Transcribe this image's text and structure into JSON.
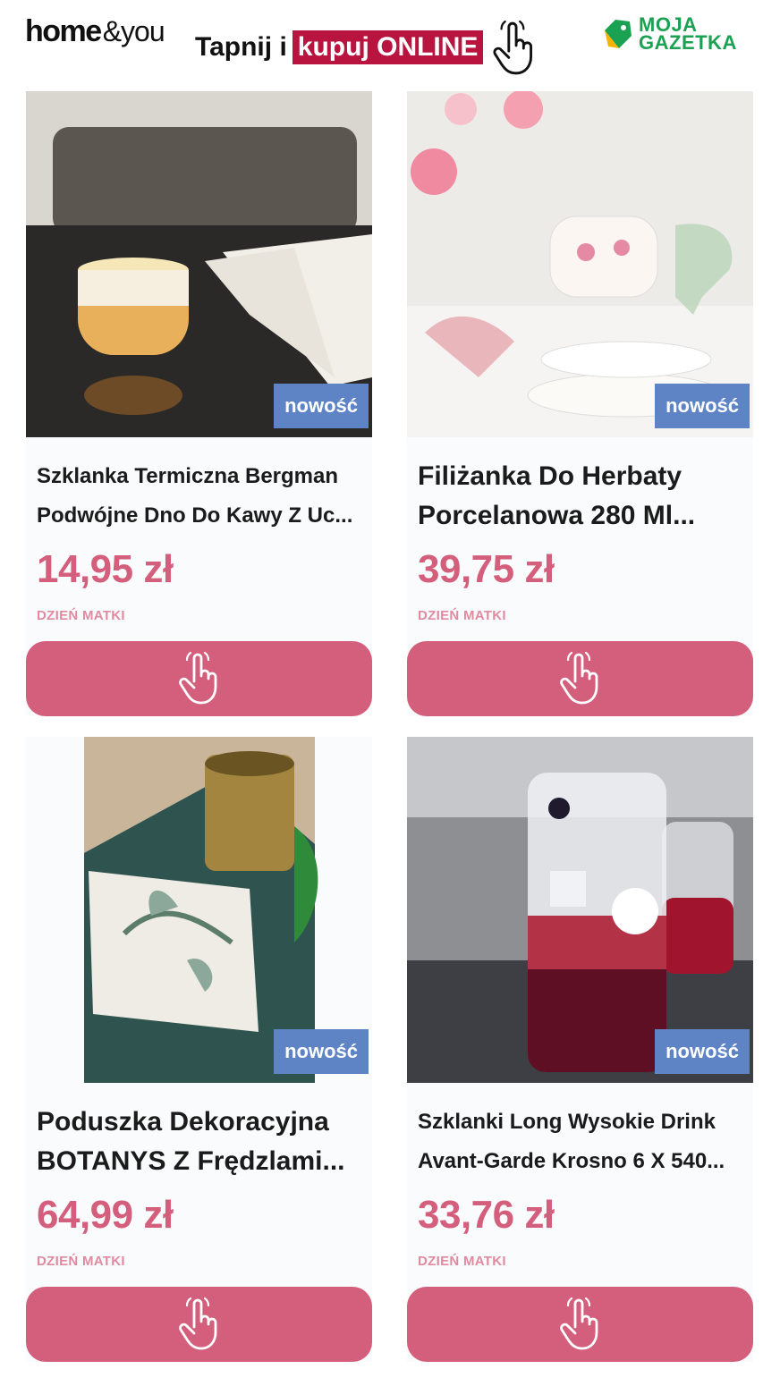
{
  "header": {
    "brand_home": "home",
    "brand_you": "&you",
    "promo_prefix": "Tapnij i",
    "promo_highlight": "kupuj ONLINE",
    "partner_line1": "MOJA",
    "partner_line2": "GAZETKA"
  },
  "colors": {
    "accent_pink": "#d45f7c",
    "badge_blue": "#5f84c6",
    "promo_red": "#b8143f",
    "partner_green": "#1aa152"
  },
  "products": [
    {
      "badge": "nowość",
      "title_line1": "Szklanka Termiczna Bergman",
      "title_line2": "Podwójne Dno Do Kawy Z Uc...",
      "price": "14,95 zł",
      "category": "DZIEŃ MATKI",
      "image": "double-wall glass with latte on table",
      "button_icon": "tap-hand-icon"
    },
    {
      "badge": "nowość",
      "title_line1": "Filiżanka Do Herbaty",
      "title_line2": "Porcelanowa 280 Ml...",
      "price": "39,75 zł",
      "category": "DZIEŃ MATKI",
      "image": "floral porcelain teacups on plates",
      "button_icon": "tap-hand-icon"
    },
    {
      "badge": "nowość",
      "title_line1": "Poduszka Dekoracyjna",
      "title_line2": "BOTANYS Z Frędzlami...",
      "price": "64,99 zł",
      "category": "DZIEŃ MATKI",
      "image": "botanical cushion on green rug with lantern",
      "button_icon": "tap-hand-icon"
    },
    {
      "badge": "nowość",
      "title_line1": "Szklanki Long Wysokie Drink",
      "title_line2": "Avant-Garde Krosno 6 X 540...",
      "price": "33,76 zł",
      "category": "DZIEŃ MATKI",
      "image": "tall glasses with red drink and ice",
      "button_icon": "tap-hand-icon"
    }
  ]
}
